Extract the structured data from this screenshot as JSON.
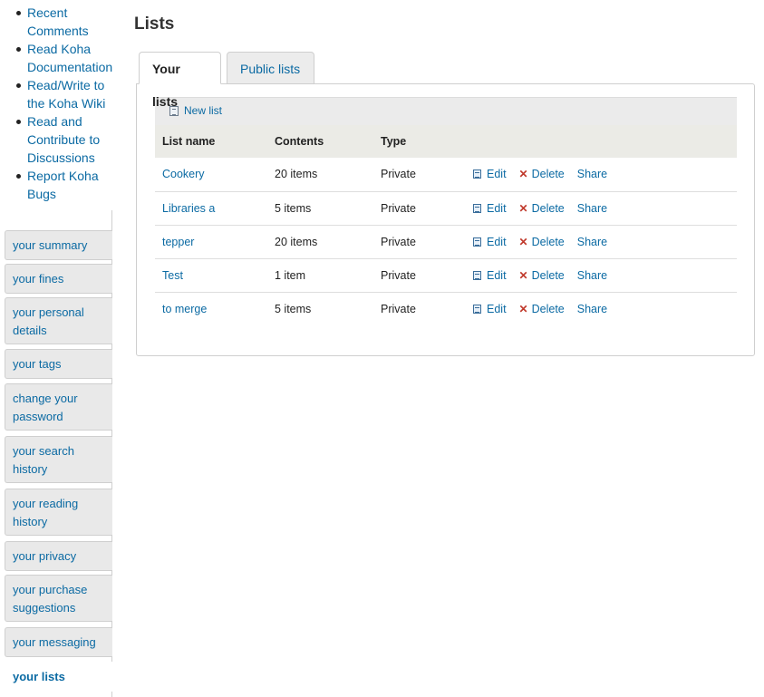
{
  "help_links": [
    {
      "label": "Recent Comments"
    },
    {
      "label": "Read Koha Documentation"
    },
    {
      "label": "Read/Write to the Koha Wiki"
    },
    {
      "label": "Read and Contribute to Discussions"
    },
    {
      "label": "Report Koha Bugs"
    }
  ],
  "usermenu": {
    "items": [
      {
        "label": "your summary",
        "active": false
      },
      {
        "label": "your fines",
        "active": false
      },
      {
        "label": "your personal details",
        "active": false
      },
      {
        "label": "your tags",
        "active": false
      },
      {
        "label": "change your password",
        "active": false
      },
      {
        "label": "your search history",
        "active": false
      },
      {
        "label": "your reading history",
        "active": false
      },
      {
        "label": "your privacy",
        "active": false
      },
      {
        "label": "your purchase suggestions",
        "active": false
      },
      {
        "label": "your messaging",
        "active": false
      },
      {
        "label": "your lists",
        "active": true
      }
    ]
  },
  "page": {
    "title": "Lists",
    "tabs": [
      {
        "label": "Your lists",
        "active": true
      },
      {
        "label": "Public lists",
        "active": false
      }
    ],
    "toolbar": {
      "new_list_label": "New list"
    },
    "table": {
      "headers": [
        "List name",
        "Contents",
        "Type",
        ""
      ],
      "rows": [
        {
          "name": "Cookery",
          "contents": "20 items",
          "type": "Private"
        },
        {
          "name": "Libraries a",
          "contents": "5 items",
          "type": "Private"
        },
        {
          "name": "tepper",
          "contents": "20 items",
          "type": "Private"
        },
        {
          "name": "Test",
          "contents": "1 item",
          "type": "Private"
        },
        {
          "name": "to merge",
          "contents": "5 items",
          "type": "Private"
        }
      ],
      "action_labels": {
        "edit": "Edit",
        "delete": "Delete",
        "share": "Share"
      }
    }
  },
  "colors": {
    "link": "#0b6aa3",
    "delete_icon": "#c0392b",
    "nav_bg": "#e9e9e9"
  },
  "icons": [
    "list-icon",
    "edit-icon",
    "delete-icon"
  ]
}
